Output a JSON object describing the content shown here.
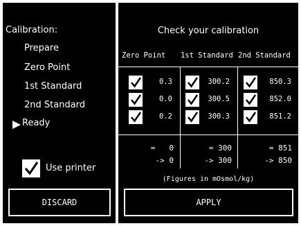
{
  "menu": {
    "title": "Calibration:",
    "items": [
      {
        "label": "Prepare"
      },
      {
        "label": "Zero Point"
      },
      {
        "label": "1st Standard"
      },
      {
        "label": "2nd Standard"
      },
      {
        "label": "Ready",
        "active": true
      }
    ]
  },
  "printer": {
    "label": "Use printer",
    "checked": true
  },
  "buttons": {
    "discard": "DISCARD",
    "apply": "APPLY"
  },
  "check": {
    "title": "Check your calibration",
    "columns": [
      {
        "header": "Zero Point",
        "readings": [
          "0.3",
          "0.0",
          "0.2"
        ],
        "summary_mean": "=   0",
        "summary_target": "-> 0"
      },
      {
        "header": "1st Standard",
        "readings": [
          "300.2",
          "300.5",
          "300.3"
        ],
        "summary_mean": "= 300",
        "summary_target": "-> 300"
      },
      {
        "header": "2nd Standard",
        "readings": [
          "850.3",
          "852.0",
          "851.2"
        ],
        "summary_mean": "= 851",
        "summary_target": "-> 850"
      }
    ],
    "units_note": "(Figures in mOsmol/kg)"
  },
  "colors": {
    "background": "#000000",
    "foreground": "#ffffff"
  },
  "icons": {
    "check": "checkbox-checked-icon",
    "ready": "triangle-right-icon"
  }
}
